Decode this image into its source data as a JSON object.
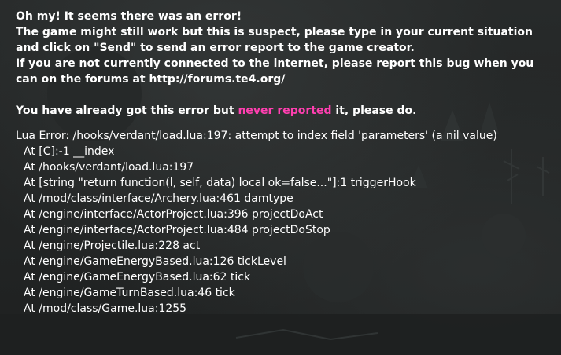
{
  "message": {
    "line1": "Oh my! It seems there was an error!",
    "line2": "The game might still work but this is suspect, please type in your current situation",
    "line3": "and click on \"Send\" to send an error report to the game creator.",
    "line4": "If you are not currently connected to the internet, please report this bug when you",
    "line5": "can on the forums at http://forums.te4.org/",
    "repeat_prefix": "You have already got this error but ",
    "repeat_highlight": "never reported",
    "repeat_suffix": " it, please do.",
    "highlight_color": "#ff3fb0"
  },
  "stack_trace": {
    "error": "Lua Error: /hooks/verdant/load.lua:197: attempt to index field 'parameters' (a nil value)",
    "frames": [
      "At [C]:-1 __index",
      "At /hooks/verdant/load.lua:197",
      "At [string \"return function(l, self, data) local ok=false...\"]:1 triggerHook",
      "At /mod/class/interface/Archery.lua:461 damtype",
      "At /engine/interface/ActorProject.lua:396 projectDoAct",
      "At /engine/interface/ActorProject.lua:484 projectDoStop",
      "At /engine/Projectile.lua:228 act",
      "At /engine/GameEnergyBased.lua:126 tickLevel",
      "At /engine/GameEnergyBased.lua:62 tick",
      "At /engine/GameTurnBased.lua:46 tick",
      "At /mod/class/Game.lua:1255"
    ]
  }
}
